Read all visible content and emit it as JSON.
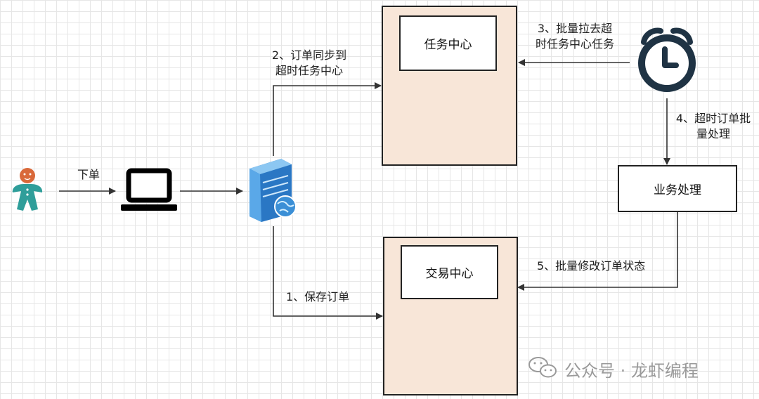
{
  "nodes": {
    "task_center": "任务中心",
    "trade_center": "交易中心",
    "business": "业务处理"
  },
  "labels": {
    "place_order": "下单",
    "step1": "1、保存订单",
    "step2_l1": "2、订单同步到",
    "step2_l2": "超时任务中心",
    "step3_l1": "3、批量拉去超",
    "step3_l2": "时任务中心任务",
    "step4_l1": "4、超时订单批",
    "step4_l2": "量处理",
    "step5": "5、批量修改订单状态"
  },
  "watermark": "公众号 · 龙虾编程",
  "colors": {
    "panel_fill": "#f8e6d8",
    "user_body": "#2f9e9a",
    "user_head": "#d9693a",
    "server_blue": "#3b8fd6",
    "clock": "#1f3344"
  },
  "icons": [
    "user-icon",
    "laptop-icon",
    "server-icon",
    "globe-icon",
    "mysql-dolphin-icon",
    "alarm-clock-icon",
    "wechat-icon"
  ]
}
